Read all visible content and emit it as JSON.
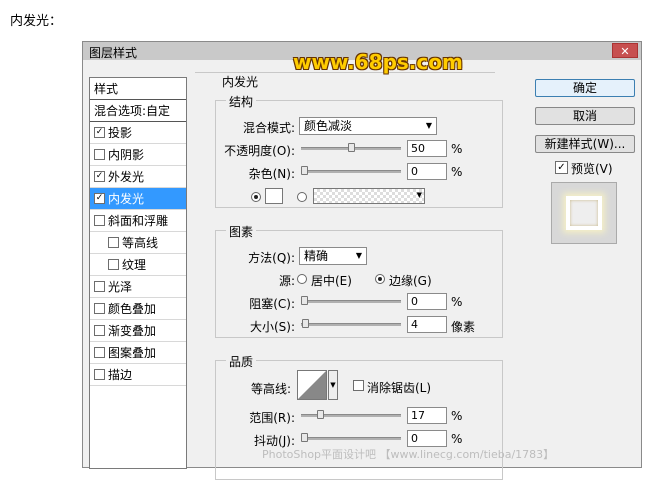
{
  "caption": "内发光：",
  "watermark_logo": "www.68ps.com",
  "watermark_footer": "PhotoShop平面设计吧 【www.linecg.com/tieba/1783】",
  "dialog": {
    "title": "图层样式",
    "close": "✕",
    "style_list": {
      "header": "样式",
      "blend_options": "混合选项:自定",
      "items": [
        {
          "label": "投影",
          "checked": "✓"
        },
        {
          "label": "内阴影",
          "checked": ""
        },
        {
          "label": "外发光",
          "checked": "✓"
        },
        {
          "label": "内发光",
          "checked": "✓"
        },
        {
          "label": "斜面和浮雕",
          "checked": ""
        },
        {
          "label": "等高线",
          "checked": ""
        },
        {
          "label": "纹理",
          "checked": ""
        },
        {
          "label": "光泽",
          "checked": ""
        },
        {
          "label": "颜色叠加",
          "checked": ""
        },
        {
          "label": "渐变叠加",
          "checked": ""
        },
        {
          "label": "图案叠加",
          "checked": ""
        },
        {
          "label": "描边",
          "checked": ""
        }
      ]
    },
    "panel_title": "内发光",
    "structure": {
      "title": "结构",
      "blend_mode_label": "混合模式:",
      "blend_mode_value": "颜色减淡",
      "opacity_label": "不透明度(O):",
      "opacity_value": "50",
      "opacity_fraction": 0.5,
      "noise_label": "杂色(N):",
      "noise_value": "0",
      "noise_fraction": 0.0,
      "percent": "%"
    },
    "elements": {
      "title": "图素",
      "method_label": "方法(Q):",
      "method_value": "精确",
      "source_label": "源:",
      "source_center": "居中(E)",
      "source_edge": "边缘(G)",
      "choke_label": "阻塞(C):",
      "choke_value": "0",
      "choke_fraction": 0.0,
      "size_label": "大小(S):",
      "size_value": "4",
      "size_fraction": 0.016,
      "size_unit": "像素",
      "percent": "%"
    },
    "quality": {
      "title": "品质",
      "contour_label": "等高线:",
      "anti_alias_label": "消除锯齿(L)",
      "range_label": "范围(R):",
      "range_value": "17",
      "range_fraction": 0.17,
      "jitter_label": "抖动(J):",
      "jitter_value": "0",
      "jitter_fraction": 0.0,
      "percent": "%"
    },
    "buttons": {
      "ok": "确定",
      "cancel": "取消",
      "new_style": "新建样式(W)...",
      "preview_label": "预览(V)",
      "preview_checked": "✓"
    }
  }
}
